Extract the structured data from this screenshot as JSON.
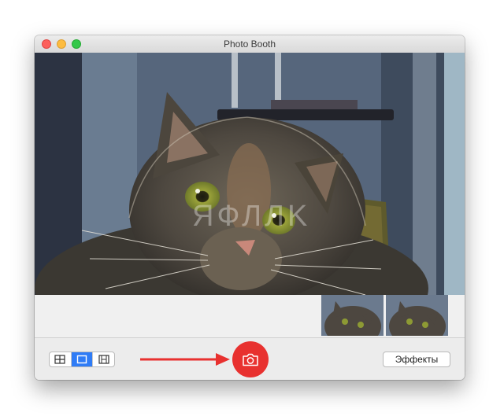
{
  "window": {
    "title": "Photo Booth"
  },
  "viewfinder": {
    "watermark": "ЯФЛЛK"
  },
  "toolbar": {
    "view_modes": [
      "four-up-view",
      "single-photo-view",
      "video-view"
    ],
    "selected_view": "single-photo-view",
    "effects_label": "Эффекты"
  },
  "colors": {
    "shutter": "#e8312f",
    "arrow": "#e8312f",
    "selected_segment": "#2f7cf6",
    "close": "#fc605c",
    "minimize": "#fdbc40",
    "zoom": "#34c84a"
  }
}
